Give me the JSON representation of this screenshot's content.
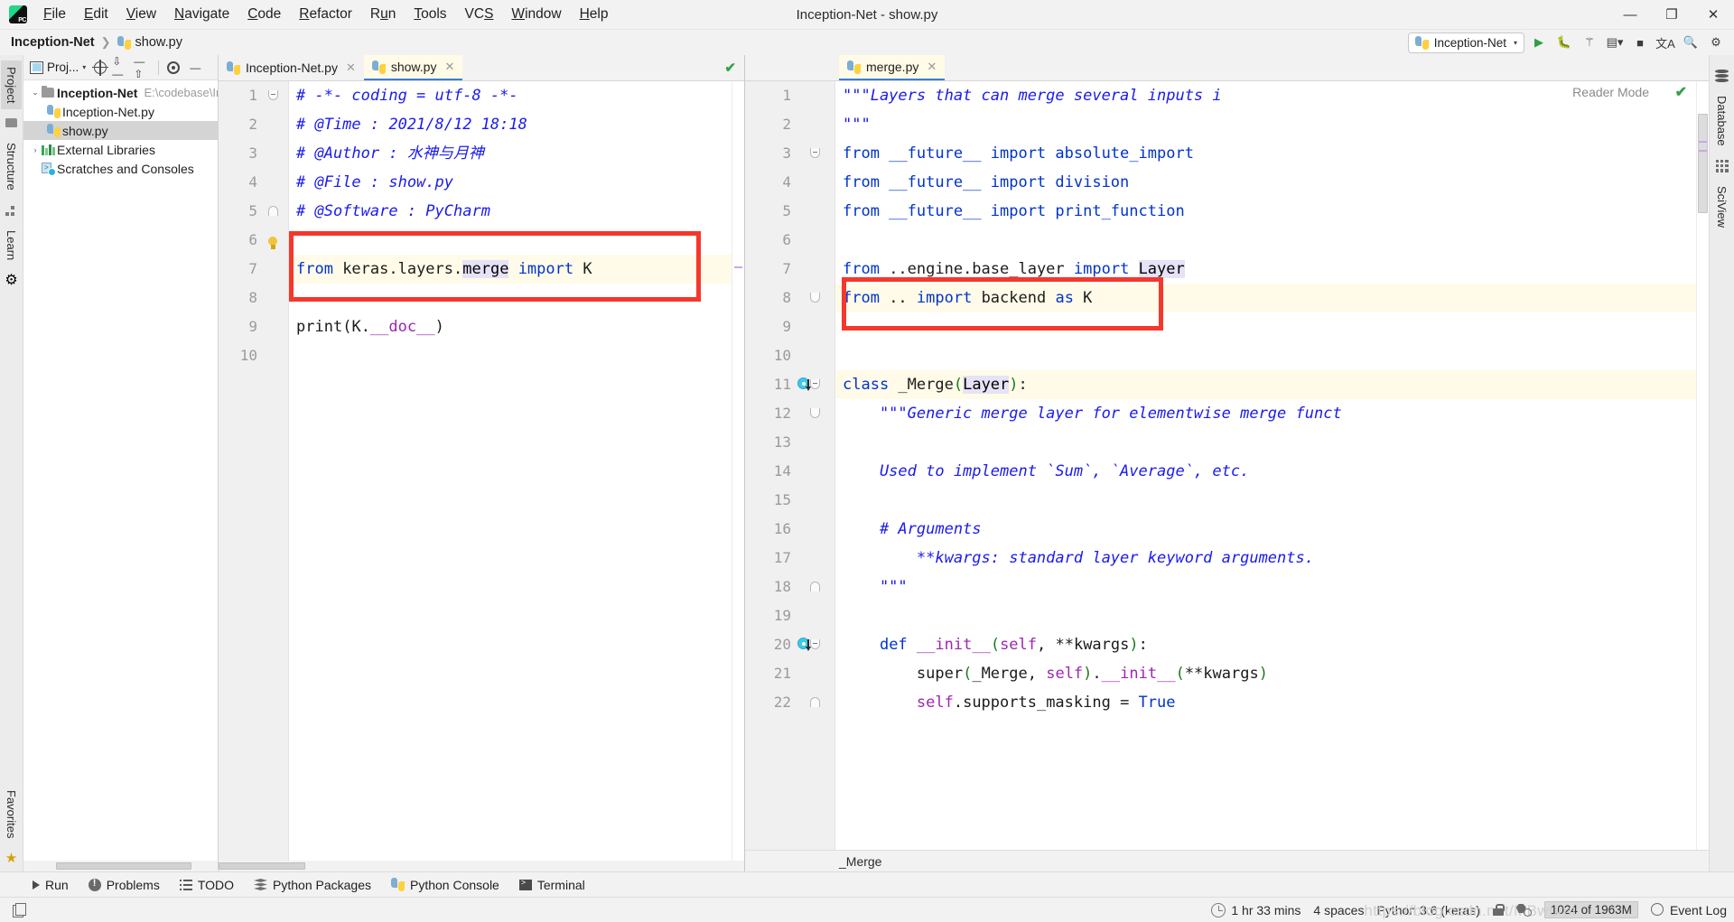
{
  "window": {
    "title": "Inception-Net - show.py",
    "logo_icon": "pycharm-logo-icon",
    "minimize_label": "—",
    "maximize_label": "❐",
    "close_label": "✕"
  },
  "menu": [
    {
      "label": "File"
    },
    {
      "label": "Edit"
    },
    {
      "label": "View"
    },
    {
      "label": "Navigate"
    },
    {
      "label": "Code"
    },
    {
      "label": "Refactor"
    },
    {
      "label": "Run"
    },
    {
      "label": "Tools"
    },
    {
      "label": "VCS"
    },
    {
      "label": "Window"
    },
    {
      "label": "Help"
    }
  ],
  "breadcrumb": {
    "project": "Inception-Net",
    "separator": "❯",
    "file": "show.py"
  },
  "toolbar": {
    "run_config_label": "Inception-Net",
    "run_config_caret": "▾",
    "run_icon": "run-play-icon",
    "debug_icon": "debug-bug-icon",
    "coverage_icon": "run-coverage-icon",
    "profile_icon": "profile-icon",
    "profile_caret": "▾",
    "stop_icon": "stop-icon",
    "translate_icon": "translate-icon",
    "search_icon": "search-icon",
    "settings_icon": "gear-icon"
  },
  "left_rail": {
    "tabs": [
      {
        "label": "Project",
        "active": true
      },
      {
        "label": "Structure",
        "active": false
      },
      {
        "label": "Learn",
        "active": false
      }
    ],
    "favorites_label": "Favorites",
    "star_icon": "star-icon"
  },
  "right_rail": {
    "tabs": [
      {
        "label": "Database",
        "icon": "database-icon"
      },
      {
        "label": "SciView",
        "icon": "grid-icon"
      }
    ]
  },
  "project_panel": {
    "title": "Proj...",
    "title_caret": "▾",
    "window_icon": "project-window-icon",
    "locate_icon": "scroll-from-source-icon",
    "expand_icon": "expand-all-icon",
    "collapse_icon": "collapse-all-icon",
    "settings_icon": "gear-icon",
    "hide_icon": "hide-panel-icon",
    "tree": [
      {
        "label": "Inception-Net",
        "path": "E:\\codebase\\In",
        "icon": "folder-icon",
        "arrow": "⌄",
        "bold": true,
        "depth": 0,
        "selected": false
      },
      {
        "label": "Inception-Net.py",
        "path": "",
        "icon": "python-file-icon",
        "arrow": "",
        "bold": false,
        "depth": 1,
        "selected": false
      },
      {
        "label": "show.py",
        "path": "",
        "icon": "python-file-icon",
        "arrow": "",
        "bold": false,
        "depth": 1,
        "selected": true
      },
      {
        "label": "External Libraries",
        "path": "",
        "icon": "library-icon",
        "arrow": "›",
        "bold": false,
        "depth": 0,
        "selected": false
      },
      {
        "label": "Scratches and Consoles",
        "path": "",
        "icon": "scratches-icon",
        "arrow": "",
        "bold": false,
        "depth": 0,
        "selected": false
      }
    ]
  },
  "left_editor": {
    "tabs": [
      {
        "label": "Inception-Net.py",
        "active": false,
        "close": "✕"
      },
      {
        "label": "show.py",
        "active": true,
        "close": "✕"
      }
    ],
    "inspection_check": "✔",
    "line_numbers": [
      1,
      2,
      3,
      4,
      5,
      6,
      7,
      8,
      9,
      10
    ],
    "lines": [
      {
        "n": 1,
        "text": "# -*- coding = utf-8 -*-",
        "kind": "comment"
      },
      {
        "n": 2,
        "text": "# @Time : 2021/8/12 18:18",
        "kind": "comment"
      },
      {
        "n": 3,
        "text": "# @Author : 水神与月神",
        "kind": "comment"
      },
      {
        "n": 4,
        "text": "# @File : show.py",
        "kind": "comment"
      },
      {
        "n": 5,
        "text": "# @Software : PyCharm",
        "kind": "comment"
      },
      {
        "n": 6,
        "text": "",
        "kind": "blank"
      },
      {
        "n": 7,
        "text": "from keras.layers.merge import K",
        "kind": "import"
      },
      {
        "n": 8,
        "text": "",
        "kind": "blank"
      },
      {
        "n": 9,
        "text": "print(K.__doc__)",
        "kind": "code"
      },
      {
        "n": 10,
        "text": "",
        "kind": "blank"
      }
    ],
    "line7_tokens": [
      {
        "t": "from",
        "c": "kw"
      },
      {
        "t": " keras.layers.",
        "c": "pl"
      },
      {
        "t": "merge",
        "c": "hl"
      },
      {
        "t": " ",
        "c": "pl"
      },
      {
        "t": "import",
        "c": "kw"
      },
      {
        "t": " K",
        "c": "pl"
      }
    ],
    "line9_tokens": [
      {
        "t": "print",
        "c": "pl"
      },
      {
        "t": "(",
        "c": "pl"
      },
      {
        "t": "K",
        "c": "pl"
      },
      {
        "t": ".",
        "c": "pl"
      },
      {
        "t": "__doc__",
        "c": "fn"
      },
      {
        "t": ")",
        "c": "pl"
      }
    ],
    "bulb_icon": "intention-bulb-icon",
    "highlight_line": 7
  },
  "right_editor": {
    "tabs": [
      {
        "label": "merge.py",
        "active": true,
        "close": "✕"
      }
    ],
    "reader_mode_label": "Reader Mode",
    "inspection_check": "✔",
    "breadcrumb": "_Merge",
    "line_numbers": [
      1,
      2,
      3,
      4,
      5,
      6,
      7,
      8,
      9,
      10,
      11,
      12,
      13,
      14,
      15,
      16,
      17,
      18,
      19,
      20,
      21,
      22
    ],
    "lines": [
      {
        "n": 1,
        "text": "\"\"\"Layers that can merge several inputs i",
        "kind": "docstring"
      },
      {
        "n": 2,
        "text": "\"\"\"",
        "kind": "docstring"
      },
      {
        "n": 3,
        "text": "from __future__ import absolute_import",
        "kind": "import"
      },
      {
        "n": 4,
        "text": "from __future__ import division",
        "kind": "import"
      },
      {
        "n": 5,
        "text": "from __future__ import print_function",
        "kind": "import"
      },
      {
        "n": 6,
        "text": "",
        "kind": "blank"
      },
      {
        "n": 7,
        "text": "from ..engine.base_layer import Layer",
        "kind": "import"
      },
      {
        "n": 8,
        "text": "from .. import backend as K",
        "kind": "import"
      },
      {
        "n": 9,
        "text": "",
        "kind": "blank"
      },
      {
        "n": 10,
        "text": "",
        "kind": "blank"
      },
      {
        "n": 11,
        "text": "class _Merge(Layer):",
        "kind": "class"
      },
      {
        "n": 12,
        "text": "    \"\"\"Generic merge layer for elementwise merge funct",
        "kind": "docstring"
      },
      {
        "n": 13,
        "text": "",
        "kind": "blank"
      },
      {
        "n": 14,
        "text": "    Used to implement `Sum`, `Average`, etc.",
        "kind": "docstring"
      },
      {
        "n": 15,
        "text": "",
        "kind": "blank"
      },
      {
        "n": 16,
        "text": "    # Arguments",
        "kind": "docstring"
      },
      {
        "n": 17,
        "text": "        **kwargs: standard layer keyword arguments.",
        "kind": "docstring"
      },
      {
        "n": 18,
        "text": "    \"\"\"",
        "kind": "docstring"
      },
      {
        "n": 19,
        "text": "",
        "kind": "blank"
      },
      {
        "n": 20,
        "text": "    def __init__(self, **kwargs):",
        "kind": "def"
      },
      {
        "n": 21,
        "text": "        super(_Merge, self).__init__(**kwargs)",
        "kind": "code"
      },
      {
        "n": 22,
        "text": "        self.supports_masking = True",
        "kind": "code"
      }
    ],
    "highlight_lines": [
      8,
      11
    ],
    "run_marker_lines": [
      11,
      20
    ],
    "run_marker_icon": "run-gutter-icon"
  },
  "annotations": {
    "box_color": "#f5372c",
    "left_box_label": "highlight-import-line-left",
    "right_box_label": "highlight-import-line-right"
  },
  "bottom_toolwindows": [
    {
      "label": "Run",
      "icon": "run-play-icon"
    },
    {
      "label": "Problems",
      "icon": "problems-icon"
    },
    {
      "label": "TODO",
      "icon": "todo-list-icon"
    },
    {
      "label": "Python Packages",
      "icon": "packages-icon"
    },
    {
      "label": "Python Console",
      "icon": "python-console-icon"
    },
    {
      "label": "Terminal",
      "icon": "terminal-icon"
    }
  ],
  "statusbar": {
    "left_icon": "toggle-toolwindows-icon",
    "time_tracking": "1 hr 33 mins",
    "time_icon": "clock-icon",
    "indent": "4 spaces",
    "interpreter": "Python 3.6 (keras)",
    "lock_icon": "lock-icon",
    "inspection_icon": "inspection-widget-icon",
    "memory": "1024 of 1963M",
    "event_log": "Event Log",
    "event_log_icon": "event-log-icon",
    "watermark": "https://blog.csdn.net/MBwurui"
  }
}
